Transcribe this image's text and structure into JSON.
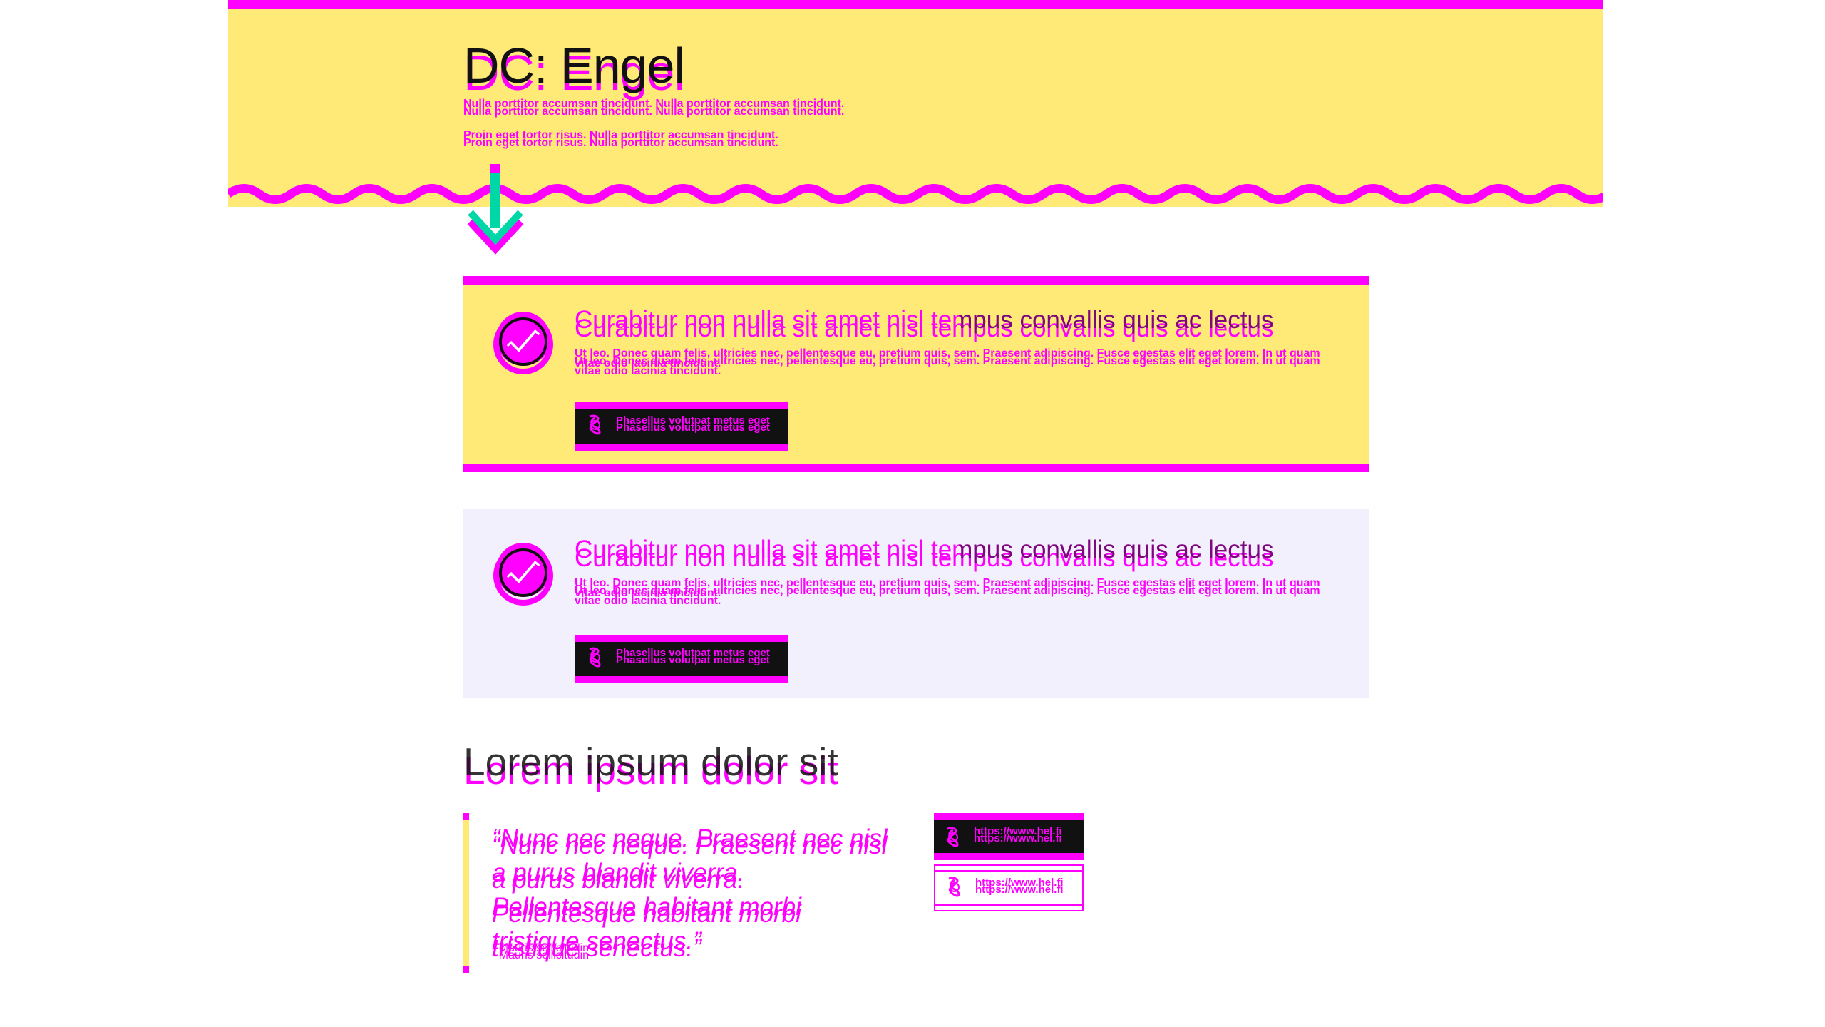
{
  "hero": {
    "title": "DC: Engel",
    "paragraph_1": "Nulla porttitor accumsan tincidunt. Nulla porttitor accumsan tincidunt.",
    "paragraph_2": "Proin eget tortor risus. Nulla porttitor accumsan tincidunt."
  },
  "cards": [
    {
      "title": "Curabitur non nulla sit amet nisl tempus convallis quis ac lectus",
      "text": "Ut leo. Donec quam felis, ultricies nec, pellentesque eu, pretium quis, sem. Praesent adipiscing. Fusce egestas elit eget lorem. In ut quam vitae odio lacinia tincidunt.",
      "button_label": "Phasellus volutpat metus eget"
    },
    {
      "title": "Curabitur non nulla sit amet nisl tempus convallis quis ac lectus",
      "text": "Ut leo. Donec quam felis, ultricies nec, pellentesque eu, pretium quis, sem. Praesent adipiscing. Fusce egestas elit eget lorem. In ut quam vitae odio lacinia tincidunt.",
      "button_label": "Phasellus volutpat metus eget"
    }
  ],
  "section": {
    "title": "Lorem ipsum dolor sit",
    "quote": "“Nunc nec neque. Praesent nec nisl a purus blandit viverra. Pellentesque habitant morbi tristique senectus.”",
    "author": "- Mauris sollicitudin",
    "links": [
      {
        "label": "https://www.hel.fi"
      },
      {
        "label": "https://www.hel.fi"
      }
    ]
  },
  "colors": {
    "accent": "#ff00ff",
    "yellow": "#ffe977",
    "teal": "#00d7a7",
    "card_alt_bg": "#f1f0fc",
    "dark": "#111111"
  }
}
